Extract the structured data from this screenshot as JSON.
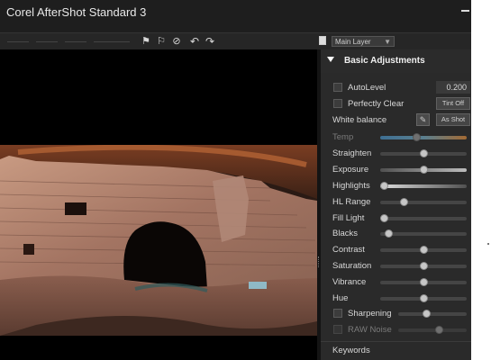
{
  "window": {
    "title": "Corel AfterShot Standard 3"
  },
  "toolbar": {
    "icons": [
      "flag-icon",
      "flag-outline-icon",
      "reject-icon",
      "rotate-left-icon",
      "rotate-right-icon"
    ],
    "layer_select": {
      "value": "Main Layer"
    }
  },
  "panel": {
    "title": "Basic Adjustments",
    "autolevel": {
      "label": "AutoLevel",
      "value": "0.200",
      "checked": false
    },
    "perfectly_clear": {
      "label": "Perfectly Clear",
      "button": "Tint Off",
      "checked": false
    },
    "white_balance": {
      "label": "White balance",
      "button": "As Shot"
    },
    "sliders": [
      {
        "label": "Temp",
        "value": 0.42,
        "dim": true
      },
      {
        "label": "Straighten",
        "value": 0.5
      },
      {
        "label": "Exposure",
        "value": 0.5
      },
      {
        "label": "Highlights",
        "value": 0.05
      },
      {
        "label": "HL Range",
        "value": 0.28
      },
      {
        "label": "Fill Light",
        "value": 0.05
      },
      {
        "label": "Blacks",
        "value": 0.1
      },
      {
        "label": "Contrast",
        "value": 0.5
      },
      {
        "label": "Saturation",
        "value": 0.5
      },
      {
        "label": "Vibrance",
        "value": 0.5
      },
      {
        "label": "Hue",
        "value": 0.5
      }
    ],
    "sharpening": {
      "label": "Sharpening",
      "value": 0.42,
      "checked": false
    },
    "raw_noise": {
      "label": "RAW Noise",
      "value": 0.6,
      "checked": false
    },
    "keywords": {
      "label": "Keywords"
    }
  }
}
